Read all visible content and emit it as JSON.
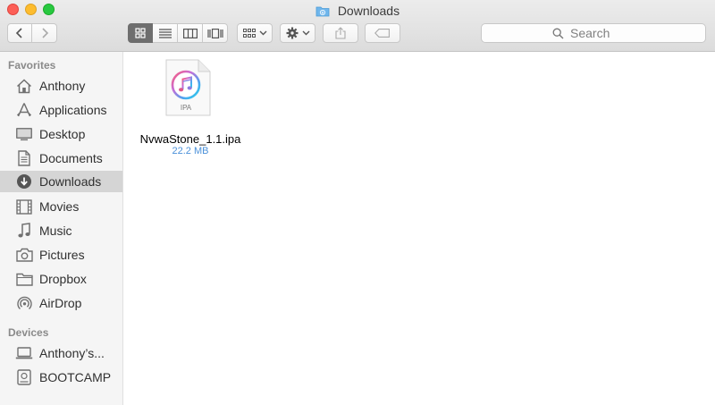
{
  "window": {
    "title": "Downloads"
  },
  "toolbar": {
    "back_icon": "chevron-left-icon",
    "forward_icon": "chevron-right-icon",
    "view_modes": [
      "icon-view",
      "list-view",
      "column-view",
      "cover-flow-view"
    ],
    "active_view": "icon-view",
    "search_placeholder": "Search"
  },
  "sidebar": {
    "favorites_heading": "Favorites",
    "favorites": [
      {
        "label": "Anthony",
        "icon": "home-icon"
      },
      {
        "label": "Applications",
        "icon": "applications-icon"
      },
      {
        "label": "Desktop",
        "icon": "desktop-icon"
      },
      {
        "label": "Documents",
        "icon": "documents-icon"
      },
      {
        "label": "Downloads",
        "icon": "downloads-icon",
        "selected": true
      },
      {
        "label": "Movies",
        "icon": "movies-icon"
      },
      {
        "label": "Music",
        "icon": "music-icon"
      },
      {
        "label": "Pictures",
        "icon": "camera-icon"
      },
      {
        "label": "Dropbox",
        "icon": "folder-icon"
      },
      {
        "label": "AirDrop",
        "icon": "airdrop-icon"
      }
    ],
    "devices_heading": "Devices",
    "devices": [
      {
        "label": "Anthony’s...",
        "icon": "laptop-icon"
      },
      {
        "label": "BOOTCAMP",
        "icon": "disk-icon"
      }
    ]
  },
  "files": [
    {
      "name": "NvwaStone_1.1.ipa",
      "size": "22.2 MB",
      "type_label": "IPA",
      "icon": "ipa-file-icon"
    }
  ],
  "colors": {
    "accent_selected": "#d5d5d5",
    "file_size": "#4a90d9",
    "active_segment": "#6e6e6e"
  }
}
